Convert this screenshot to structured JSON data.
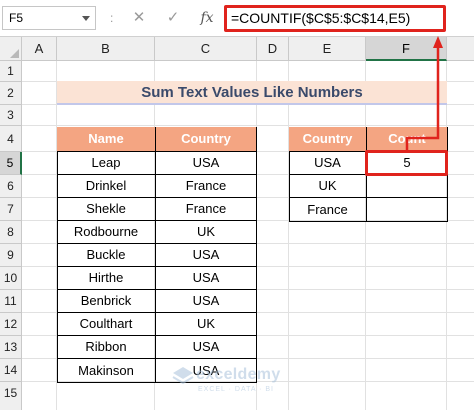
{
  "formula_bar": {
    "name_box": "F5",
    "separator": ":",
    "cancel_glyph": "✕",
    "enter_glyph": "✓",
    "fx_label": "fx",
    "formula": "=COUNTIF($C$5:$C$14,E5)"
  },
  "columns": [
    "A",
    "B",
    "C",
    "D",
    "E",
    "F"
  ],
  "selected_column": "F",
  "rows": [
    "1",
    "2",
    "3",
    "4",
    "5",
    "6",
    "7",
    "8",
    "9",
    "10",
    "11",
    "12",
    "13",
    "14",
    "15"
  ],
  "selected_row": "5",
  "title": "Sum Text Values Like Numbers",
  "left_table": {
    "headers": [
      "Name",
      "Country"
    ],
    "rows": [
      [
        "Leap",
        "USA"
      ],
      [
        "Drinkel",
        "France"
      ],
      [
        "Shekle",
        "France"
      ],
      [
        "Rodbourne",
        "UK"
      ],
      [
        "Buckle",
        "USA"
      ],
      [
        "Hirthe",
        "USA"
      ],
      [
        "Benbrick",
        "USA"
      ],
      [
        "Coulthart",
        "UK"
      ],
      [
        "Ribbon",
        "USA"
      ],
      [
        "Makinson",
        "USA"
      ]
    ]
  },
  "right_table": {
    "headers": [
      "Country",
      "Count"
    ],
    "rows": [
      [
        "USA",
        "5"
      ],
      [
        "UK",
        ""
      ],
      [
        "France",
        ""
      ]
    ]
  },
  "watermark": {
    "name": "exceldemy",
    "tagline": "EXCEL · DATA · BI"
  },
  "colors": {
    "header_fill": "#f4a582",
    "title_fill": "#fbe3d5",
    "title_text": "#3a4a6b",
    "highlight": "#e0231d",
    "selection": "#217346"
  }
}
